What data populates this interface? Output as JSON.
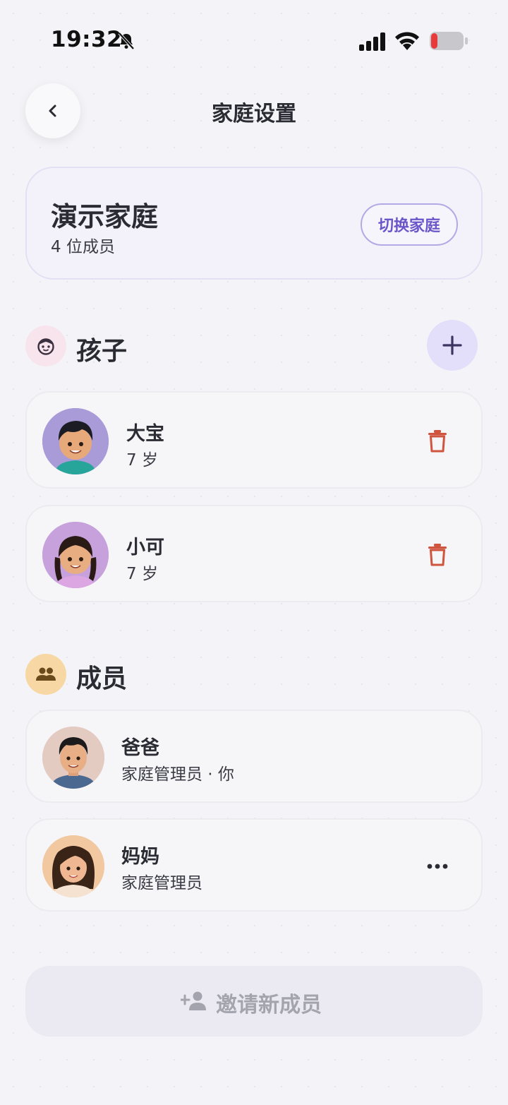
{
  "status_bar": {
    "time": "19:32"
  },
  "header": {
    "title": "家庭设置"
  },
  "family": {
    "name": "演示家庭",
    "member_count": "4 位成员",
    "switch_label": "切换家庭"
  },
  "children_section": {
    "title": "孩子",
    "items": [
      {
        "name": "大宝",
        "age": "7 岁"
      },
      {
        "name": "小可",
        "age": "7 岁"
      }
    ]
  },
  "members_section": {
    "title": "成员",
    "items": [
      {
        "name": "爸爸",
        "role": "家庭管理员 · 你"
      },
      {
        "name": "妈妈",
        "role": "家庭管理员"
      }
    ]
  },
  "invite": {
    "label": "邀请新成员"
  },
  "colors": {
    "accent": "#6b56c9",
    "danger": "#d0553f",
    "background": "#f4f4f8"
  }
}
